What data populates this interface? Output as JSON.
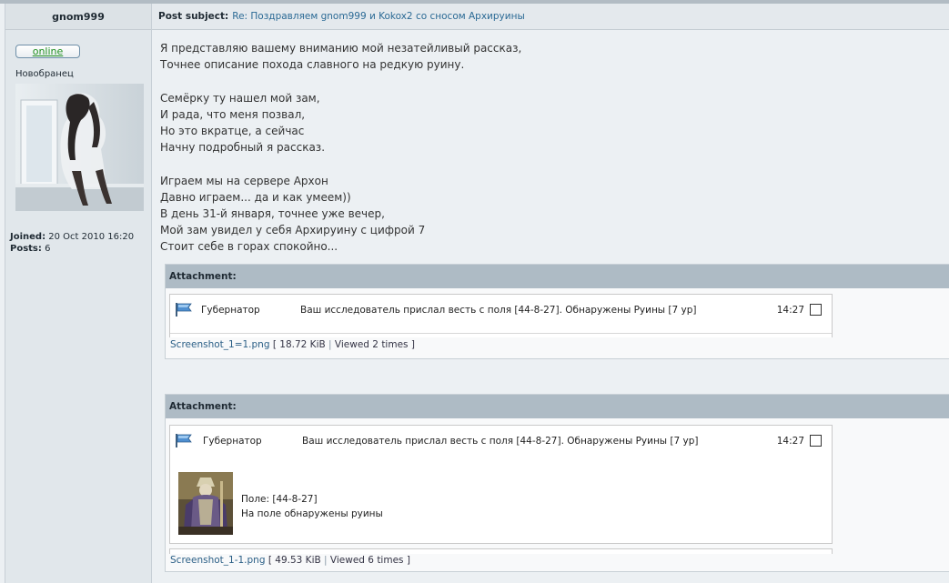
{
  "author": {
    "username": "gnom999",
    "status": "online",
    "rank": "Новобранец",
    "joined_label": "Joined:",
    "joined_value": "20 Oct 2010 16:20",
    "posts_label": "Posts:",
    "posts_value": "6"
  },
  "post": {
    "subject_label": "Post subject:",
    "subject": "Re: Поздравляем gnom999 и Kokox2 со сносом Архируины",
    "lines": [
      "Я представляю вашему вниманию мой незатейливый рассказ,",
      "Точнее описание похода славного на редкую руину.",
      "",
      "Семёрку ту нашел мой зам,",
      "И рада, что меня позвал,",
      "Но это вкратце, а сейчас",
      "Начну подробный я рассказ.",
      "",
      "Играем мы на сервере Архон",
      "Давно играем... да и как умеем))",
      "В день 31-й января, точнее уже вечер,",
      "Мой зам увидел у себя Архируину с цифрой 7",
      "Стоит себе в горах спокойно..."
    ]
  },
  "attachments": [
    {
      "header": "Attachment:",
      "sender": "Губернатор",
      "message": "Ваш исследователь прислал весть с поля [44-8-27]. Обнаружены Руины [7 ур]",
      "time": "14:27",
      "filename": "Screenshot_1=1.png",
      "size": "18.72 KiB",
      "views": "Viewed 2 times"
    },
    {
      "header": "Attachment:",
      "sender": "Губернатор",
      "message": "Ваш исследователь прислал весть с поля [44-8-27]. Обнаружены Руины [7 ур]",
      "time": "14:27",
      "field_line": "Поле: [44-8-27]",
      "ruins_line": "На поле обнаружены руины",
      "filename": "Screenshot_1-1.png",
      "size": "49.53 KiB",
      "views": "Viewed 6 times"
    }
  ],
  "colors": {
    "online_green": "#1F8F1F",
    "link_blue": "#2B6A95",
    "attachment_header": "#AEBBC5"
  }
}
